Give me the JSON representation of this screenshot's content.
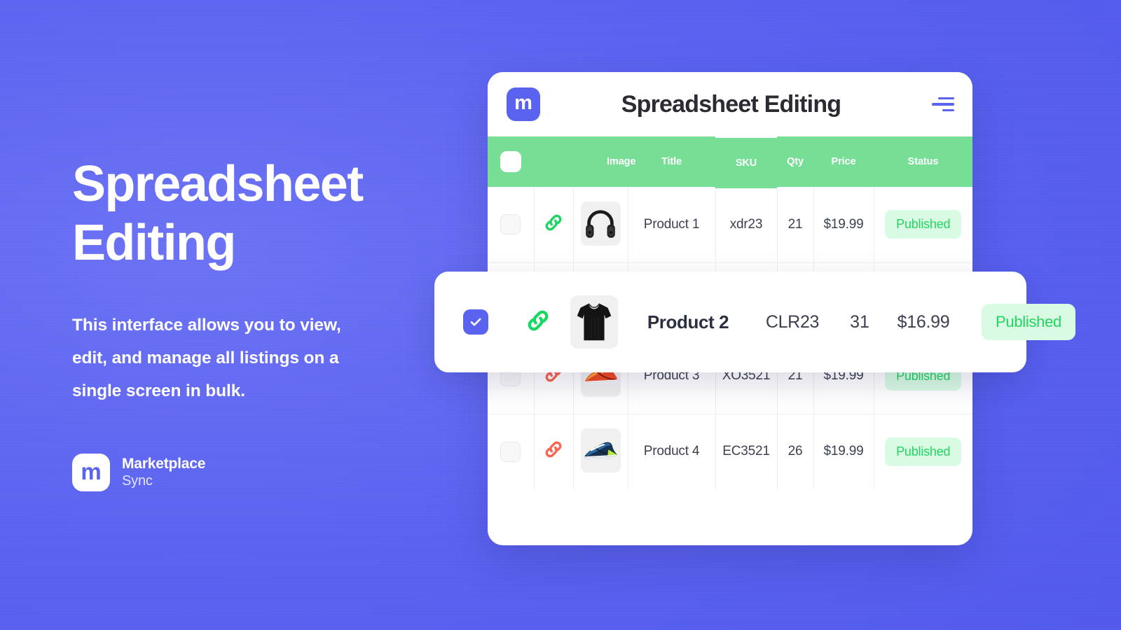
{
  "hero": {
    "title": "Spreadsheet\nEditing",
    "description": "This interface allows you to view, edit, and manage all listings on a single screen in bulk.",
    "brand_mark": "m",
    "brand_name": "Marketplace",
    "brand_sub": "Sync"
  },
  "app": {
    "logo_mark": "m",
    "title": "Spreadsheet Editing",
    "menu_icon": "hamburger-icon"
  },
  "table": {
    "columns": [
      "",
      "",
      "Image",
      "Title",
      "SKU",
      "Qty",
      "Price",
      "Status"
    ],
    "header": {
      "image": "Image",
      "title": "Title",
      "sku": "SKU",
      "qty": "Qty",
      "price": "Price",
      "status": "Status"
    },
    "rows": [
      {
        "checked": false,
        "link_icon": "link-icon",
        "link_color": "#18d863",
        "image": "headphones",
        "title": "Product 1",
        "sku": "xdr23",
        "qty": "21",
        "price": "$19.99",
        "status": "Published"
      },
      {
        "checked": true,
        "link_icon": "link-icon",
        "link_color": "#18d863",
        "image": "tshirt",
        "title": "Product 2",
        "sku": "CLR23",
        "qty": "31",
        "price": "$16.99",
        "status": "Published",
        "highlighted": true
      },
      {
        "checked": false,
        "link_icon": "link-icon",
        "link_color": "#fa6450",
        "image": "orange-sneaker",
        "title": "Product 3",
        "sku": "XO3521",
        "qty": "21",
        "price": "$19.99",
        "status": "Published"
      },
      {
        "checked": false,
        "link_icon": "link-icon",
        "link_color": "#fa6450",
        "image": "blue-sneaker",
        "title": "Product 4",
        "sku": "EC3521",
        "qty": "26",
        "price": "$19.99",
        "status": "Published"
      }
    ]
  },
  "colors": {
    "background": "#5a62f0",
    "accent": "#5a62f0",
    "table_header": "#76de95",
    "badge_bg": "#d9fbe4",
    "badge_text": "#20d660",
    "link_green": "#18d863",
    "link_red": "#fa6450"
  }
}
